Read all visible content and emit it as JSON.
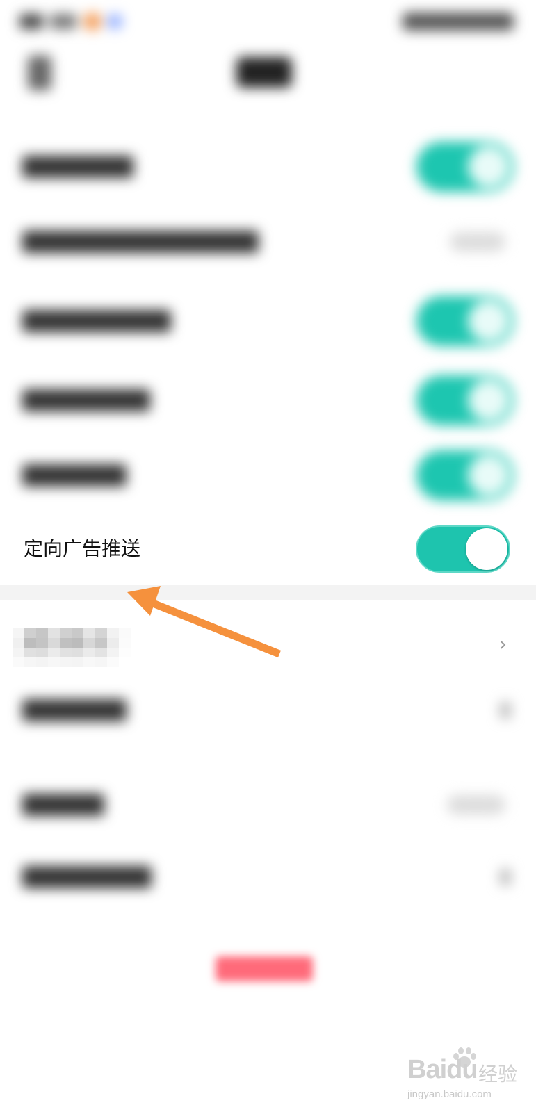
{
  "settings": {
    "ad_push_label": "定向广告推送",
    "ad_push_toggle_on": true,
    "more_chevron": "›"
  },
  "watermark": {
    "brand": "Baidu",
    "brand_cn": "经验",
    "url": "jingyan.baidu.com"
  },
  "colors": {
    "toggle_on": "#1ec4ae",
    "arrow": "#f5913d",
    "logout": "#ff6a7a"
  },
  "icons": {
    "back": "chevron-left-icon",
    "more": "chevron-right-icon",
    "arrow": "annotation-arrow-icon"
  }
}
